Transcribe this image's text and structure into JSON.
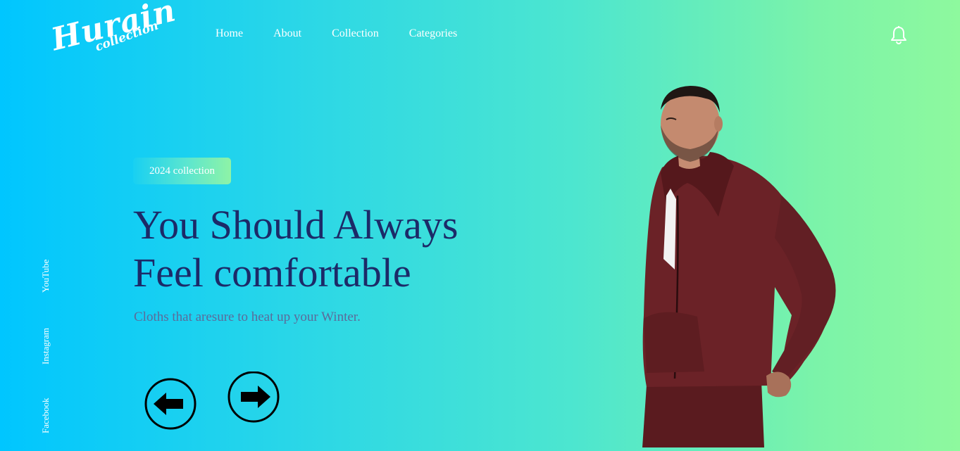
{
  "brand": {
    "logo_main": "Hurain",
    "logo_sub": "collection"
  },
  "nav": {
    "items": [
      {
        "label": "Home"
      },
      {
        "label": "About"
      },
      {
        "label": "Collection"
      },
      {
        "label": "Categories"
      }
    ]
  },
  "header": {
    "notification_icon": "bell-icon"
  },
  "socials": {
    "items": [
      {
        "label": "YouTube"
      },
      {
        "label": "Instagram"
      },
      {
        "label": "Facebook"
      }
    ]
  },
  "hero": {
    "badge": "2024 collection",
    "title_line1": "You Should Always",
    "title_line2": "Feel comfortable",
    "subtitle": "Cloths that aresure to heat up your Winter.",
    "prev_icon": "arrow-left-icon",
    "next_icon": "arrow-right-icon"
  },
  "colors": {
    "gradient_start": "#00c6ff",
    "gradient_end": "#8ef99e",
    "headline": "#1c2a68",
    "subtitle": "#5b6b9a",
    "nav_text": "#ffffff"
  }
}
